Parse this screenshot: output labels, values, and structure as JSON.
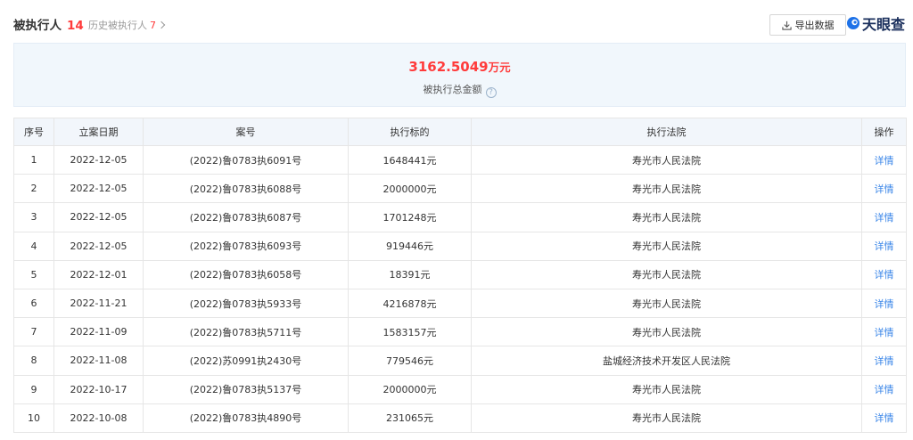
{
  "header": {
    "title": "被执行人",
    "count": "14",
    "history_label": "历史被执行人",
    "history_count": "7",
    "export_label": "导出数据",
    "logo_text": "天眼查"
  },
  "summary": {
    "amount": "3162.5049",
    "unit": "万元",
    "label": "被执行总金额",
    "help": "?"
  },
  "table": {
    "columns": [
      "序号",
      "立案日期",
      "案号",
      "执行标的",
      "执行法院",
      "操作"
    ],
    "rows": [
      {
        "no": "1",
        "date": "2022-12-05",
        "case": "(2022)鲁0783执6091号",
        "amount": "1648441元",
        "court": "寿光市人民法院",
        "op": "详情"
      },
      {
        "no": "2",
        "date": "2022-12-05",
        "case": "(2022)鲁0783执6088号",
        "amount": "2000000元",
        "court": "寿光市人民法院",
        "op": "详情"
      },
      {
        "no": "3",
        "date": "2022-12-05",
        "case": "(2022)鲁0783执6087号",
        "amount": "1701248元",
        "court": "寿光市人民法院",
        "op": "详情"
      },
      {
        "no": "4",
        "date": "2022-12-05",
        "case": "(2022)鲁0783执6093号",
        "amount": "919446元",
        "court": "寿光市人民法院",
        "op": "详情"
      },
      {
        "no": "5",
        "date": "2022-12-01",
        "case": "(2022)鲁0783执6058号",
        "amount": "18391元",
        "court": "寿光市人民法院",
        "op": "详情"
      },
      {
        "no": "6",
        "date": "2022-11-21",
        "case": "(2022)鲁0783执5933号",
        "amount": "4216878元",
        "court": "寿光市人民法院",
        "op": "详情"
      },
      {
        "no": "7",
        "date": "2022-11-09",
        "case": "(2022)鲁0783执5711号",
        "amount": "1583157元",
        "court": "寿光市人民法院",
        "op": "详情"
      },
      {
        "no": "8",
        "date": "2022-11-08",
        "case": "(2022)苏0991执2430号",
        "amount": "779546元",
        "court": "盐城经济技术开发区人民法院",
        "op": "详情"
      },
      {
        "no": "9",
        "date": "2022-10-17",
        "case": "(2022)鲁0783执5137号",
        "amount": "2000000元",
        "court": "寿光市人民法院",
        "op": "详情"
      },
      {
        "no": "10",
        "date": "2022-10-08",
        "case": "(2022)鲁0783执4890号",
        "amount": "231065元",
        "court": "寿光市人民法院",
        "op": "详情"
      }
    ]
  },
  "colors": {
    "accent_red": "#ff3b3b",
    "link_blue": "#3a86e8",
    "summary_bg": "#f1f7fc",
    "header_bg": "#f2f6fb",
    "logo_blue": "#1a2f5c"
  },
  "icons": {
    "export": "download-icon",
    "logo": "tianyancha-logo-icon"
  }
}
